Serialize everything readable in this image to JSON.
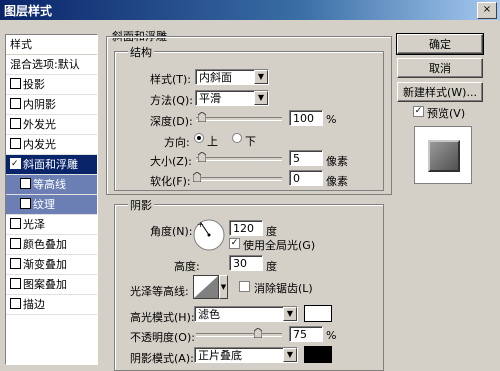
{
  "window": {
    "title": "图层样式",
    "close_glyph": "×"
  },
  "sidebar": {
    "header": "样式",
    "blend_options": "混合选项:默认",
    "items": [
      {
        "label": "投影",
        "checked": false
      },
      {
        "label": "内阴影",
        "checked": false
      },
      {
        "label": "外发光",
        "checked": false
      },
      {
        "label": "内发光",
        "checked": false
      },
      {
        "label": "斜面和浮雕",
        "checked": true,
        "selected": true
      },
      {
        "label": "等高线",
        "checked": false,
        "sub": true
      },
      {
        "label": "纹理",
        "checked": false,
        "sub": true
      },
      {
        "label": "光泽",
        "checked": false
      },
      {
        "label": "颜色叠加",
        "checked": false
      },
      {
        "label": "渐变叠加",
        "checked": false
      },
      {
        "label": "图案叠加",
        "checked": false
      },
      {
        "label": "描边",
        "checked": false
      }
    ]
  },
  "bevel": {
    "section_title": "斜面和浮雕",
    "structure_title": "结构",
    "style_label": "样式(T):",
    "style_value": "内斜面",
    "technique_label": "方法(Q):",
    "technique_value": "平滑",
    "depth_label": "深度(D):",
    "depth_value": "100",
    "depth_unit": "%",
    "depth_level": 0.02,
    "direction_label": "方向:",
    "direction_up": "上",
    "direction_down": "下",
    "direction_selected": "up",
    "size_label": "大小(Z):",
    "size_value": "5",
    "size_unit": "像素",
    "size_level": 0.02,
    "soften_label": "软化(F):",
    "soften_value": "0",
    "soften_unit": "像素",
    "soften_level": 0.0
  },
  "shading": {
    "title": "阴影",
    "angle_label": "角度(N):",
    "angle_value": "120",
    "angle_unit": "度",
    "global_light_label": "使用全局光(G)",
    "global_light_checked": true,
    "altitude_label": "高度:",
    "altitude_value": "30",
    "altitude_unit": "度",
    "gloss_label": "光泽等高线:",
    "antialias_label": "消除锯齿(L)",
    "antialias_checked": false,
    "highlight_mode_label": "高光模式(H):",
    "highlight_mode_value": "滤色",
    "highlight_color": "#ffffff",
    "opacity_label": "不透明度(O):",
    "opacity_value": "75",
    "opacity_unit": "%",
    "opacity_level": 0.75,
    "shadow_mode_label": "阴影模式(A):",
    "shadow_mode_value": "正片叠底",
    "shadow_color": "#000000"
  },
  "buttons": {
    "ok": "确定",
    "cancel": "取消",
    "new_style": "新建样式(W)...",
    "preview_label": "预览(V)",
    "preview_checked": true
  },
  "colors": {
    "title_start": "#0a246a",
    "selection": "#0a246a",
    "sub_selection": "#6b7fb4",
    "face": "#d4d0c8"
  }
}
